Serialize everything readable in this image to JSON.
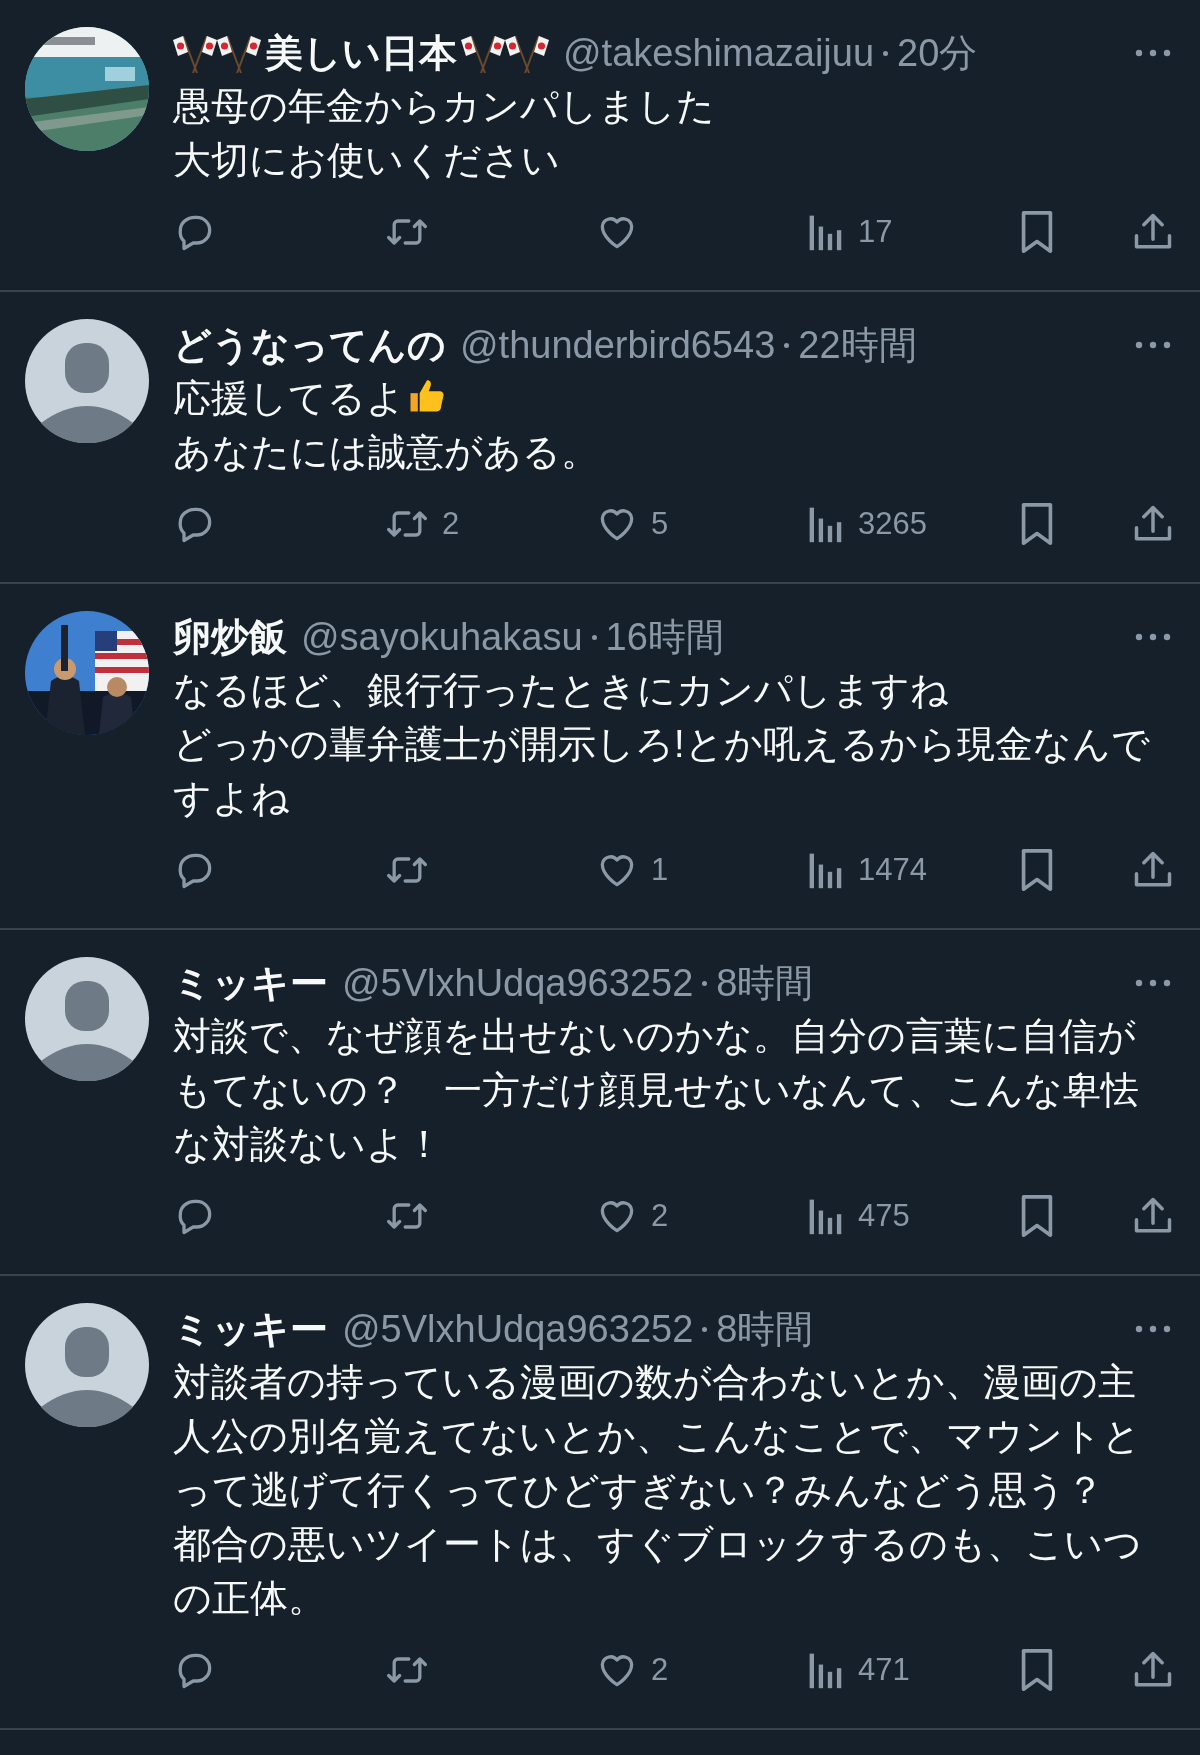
{
  "tweets": [
    {
      "avatar": {
        "kind": "picture"
      },
      "flags": true,
      "name": "美しい日本",
      "handle": "@takeshimazaijuu",
      "time": "20分",
      "body": [
        {
          "kind": "text",
          "text": "愚母の年金からカンパしました"
        },
        {
          "kind": "break"
        },
        {
          "kind": "text",
          "text": "大切にお使いください"
        }
      ],
      "views": "17"
    },
    {
      "avatar": {
        "kind": "default"
      },
      "flags": false,
      "name": "どうなってんの",
      "handle": "@thunderbird6543",
      "time": "22時間",
      "body": [
        {
          "kind": "text",
          "text": "応援してるよ"
        },
        {
          "kind": "thumbs-up"
        },
        {
          "kind": "break"
        },
        {
          "kind": "text",
          "text": "あなたには誠意がある。"
        }
      ],
      "retweets": "2",
      "likes": "5",
      "views": "3265"
    },
    {
      "avatar": {
        "kind": "picture"
      },
      "flags": false,
      "name": "卵炒飯",
      "handle": "@sayokuhakasu",
      "time": "16時間",
      "body": [
        {
          "kind": "text",
          "text": "なるほど、銀行行ったときにカンパしますね"
        },
        {
          "kind": "break"
        },
        {
          "kind": "text",
          "text": "どっかの輩弁護士が開示しろ!とか吼えるから現金なんですよね"
        }
      ],
      "likes": "1",
      "views": "1474"
    },
    {
      "avatar": {
        "kind": "default"
      },
      "flags": false,
      "name": "ミッキー",
      "handle": "@5VlxhUdqa963252",
      "time": "8時間",
      "body": [
        {
          "kind": "text",
          "text": "対談で、なぜ顔を出せないのかな。自分の言葉に自信がもてないの？　一方だけ顔見せないなんて、こんな卑怯な対談ないよ！"
        }
      ],
      "likes": "2",
      "views": "475"
    },
    {
      "avatar": {
        "kind": "default"
      },
      "flags": false,
      "name": "ミッキー",
      "handle": "@5VlxhUdqa963252",
      "time": "8時間",
      "body": [
        {
          "kind": "text",
          "text": "対談者の持っている漫画の数が合わないとか、漫画の主人公の別名覚えてないとか、こんなことで、マウントとって逃げて行くってひどすぎない？みんなどう思う？"
        },
        {
          "kind": "break"
        },
        {
          "kind": "text",
          "text": "都合の悪いツイートは、すぐブロックするのも、こいつの正体。"
        }
      ],
      "likes": "2",
      "views": "471"
    }
  ]
}
